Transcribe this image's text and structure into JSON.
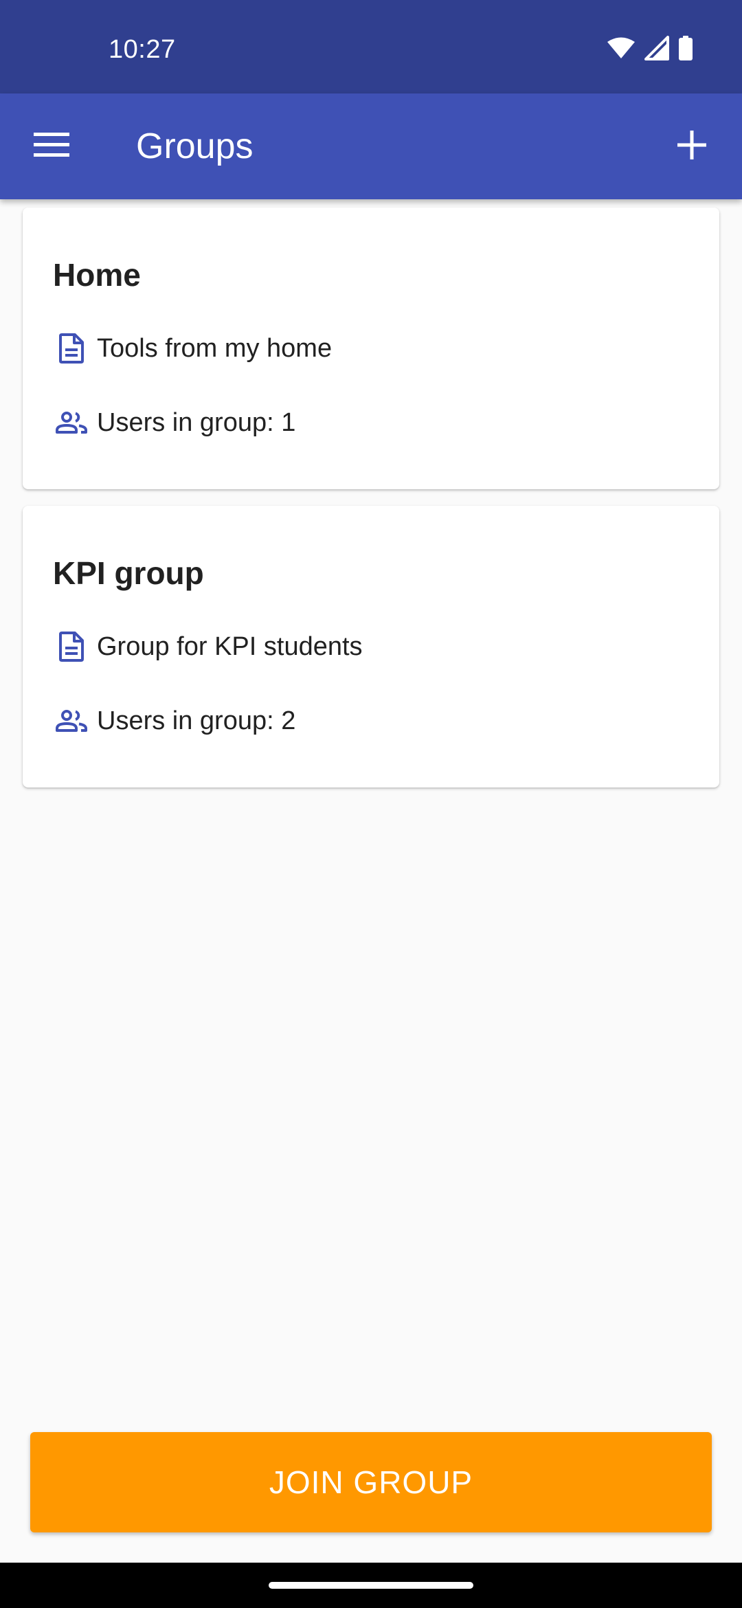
{
  "status_bar": {
    "time": "10:27",
    "icons": [
      "wifi-icon",
      "signal-icon",
      "battery-icon"
    ]
  },
  "app_bar": {
    "title": "Groups",
    "menu_icon": "hamburger-menu-icon",
    "add_icon": "plus-icon"
  },
  "groups": [
    {
      "name": "Home",
      "description": "Tools from my home",
      "users": "Users in group: 1"
    },
    {
      "name": "KPI group",
      "description": "Group for KPI students",
      "users": "Users in group: 2"
    }
  ],
  "join_button": {
    "label": "JOIN GROUP"
  },
  "colors": {
    "status_bar": "#303f8f",
    "primary": "#3f51b5",
    "accent": "#ff9800",
    "background": "#fafafa",
    "card": "#ffffff",
    "text": "#212121"
  }
}
